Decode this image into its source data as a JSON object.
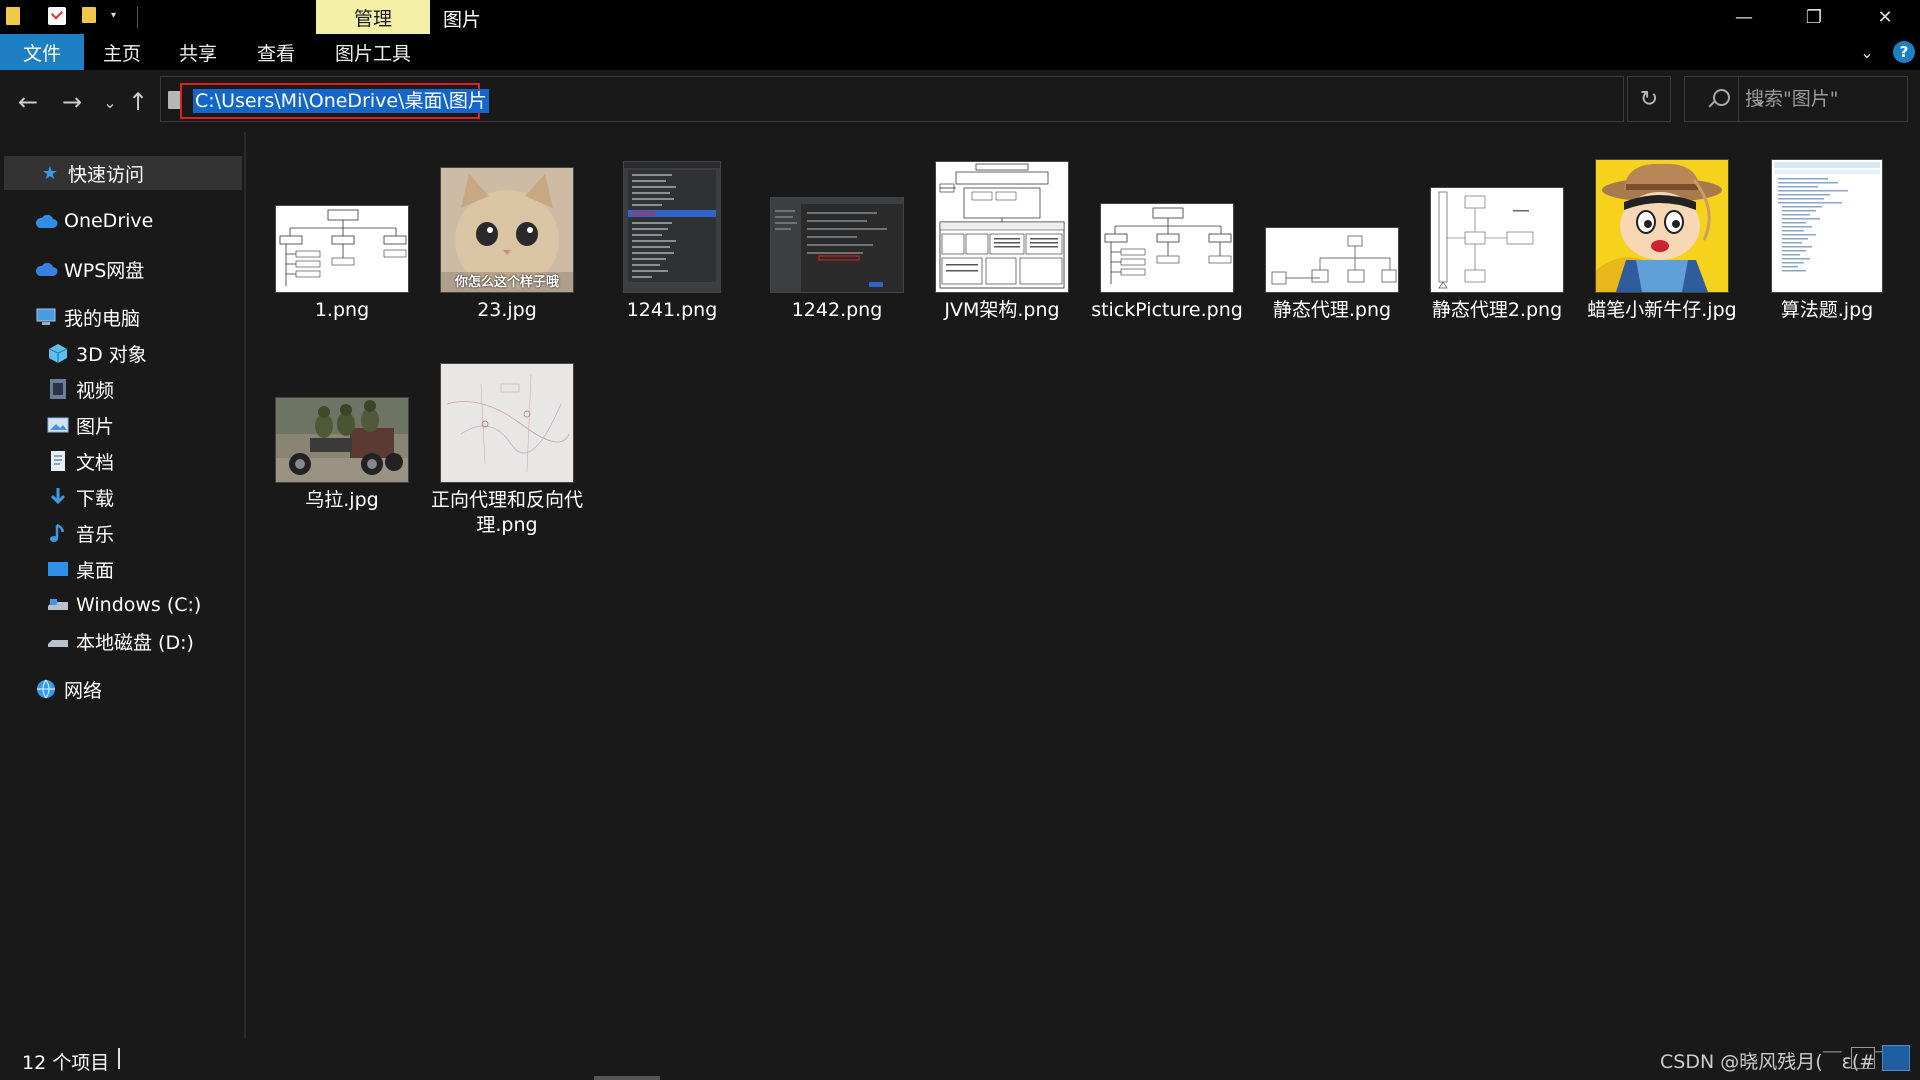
{
  "window": {
    "contextual_tab": "管理",
    "title": "图片",
    "minimize_glyph": "—",
    "restore_glyph": "❐",
    "close_glyph": "✕",
    "qat_dropdown_glyph": "▾"
  },
  "ribbon": {
    "tabs": [
      "文件",
      "主页",
      "共享",
      "查看",
      "图片工具"
    ],
    "expand_glyph": "⌄",
    "help_glyph": "?"
  },
  "nav": {
    "back_glyph": "←",
    "forward_glyph": "→",
    "recent_glyph": "⌄",
    "up_glyph": "↑",
    "address": "C:\\Users\\Mi\\OneDrive\\桌面\\图片",
    "dropdown_glyph": "⌄",
    "refresh_glyph": "↻",
    "search_placeholder": "搜索\"图片\""
  },
  "sidebar": {
    "items": [
      {
        "label": "快速访问",
        "icon": "star-icon"
      },
      {
        "label": "OneDrive",
        "icon": "cloud-icon"
      },
      {
        "label": "WPS网盘",
        "icon": "cloud-icon"
      },
      {
        "label": "我的电脑",
        "icon": "computer-icon"
      },
      {
        "label": "3D 对象",
        "icon": "cube-icon"
      },
      {
        "label": "视频",
        "icon": "video-icon"
      },
      {
        "label": "图片",
        "icon": "picture-icon"
      },
      {
        "label": "文档",
        "icon": "document-icon"
      },
      {
        "label": "下载",
        "icon": "download-icon"
      },
      {
        "label": "音乐",
        "icon": "music-icon"
      },
      {
        "label": "桌面",
        "icon": "desktop-icon"
      },
      {
        "label": "Windows (C:)",
        "icon": "drive-icon"
      },
      {
        "label": "本地磁盘 (D:)",
        "icon": "drive-icon"
      },
      {
        "label": "网络",
        "icon": "network-icon"
      }
    ]
  },
  "files": [
    {
      "name": "1.png"
    },
    {
      "name": "23.jpg",
      "caption": "你怎么这个样子哦"
    },
    {
      "name": "1241.png"
    },
    {
      "name": "1242.png"
    },
    {
      "name": "JVM架构.png"
    },
    {
      "name": "stickPicture.png"
    },
    {
      "name": "静态代理.png"
    },
    {
      "name": "静态代理2.png"
    },
    {
      "name": "蜡笔小新牛仔.jpg"
    },
    {
      "name": "算法题.jpg"
    },
    {
      "name": "乌拉.jpg"
    },
    {
      "name": "正向代理和反向代理.png"
    }
  ],
  "status": {
    "item_count": "12 个项目",
    "watermark": "CSDN @晓风残月(￣ε(#￣"
  },
  "colors": {
    "accent": "#1e7fc2",
    "contextual_tab_bg": "#f4f0a6",
    "address_highlight": "#e02020",
    "selection": "#1466c8"
  }
}
